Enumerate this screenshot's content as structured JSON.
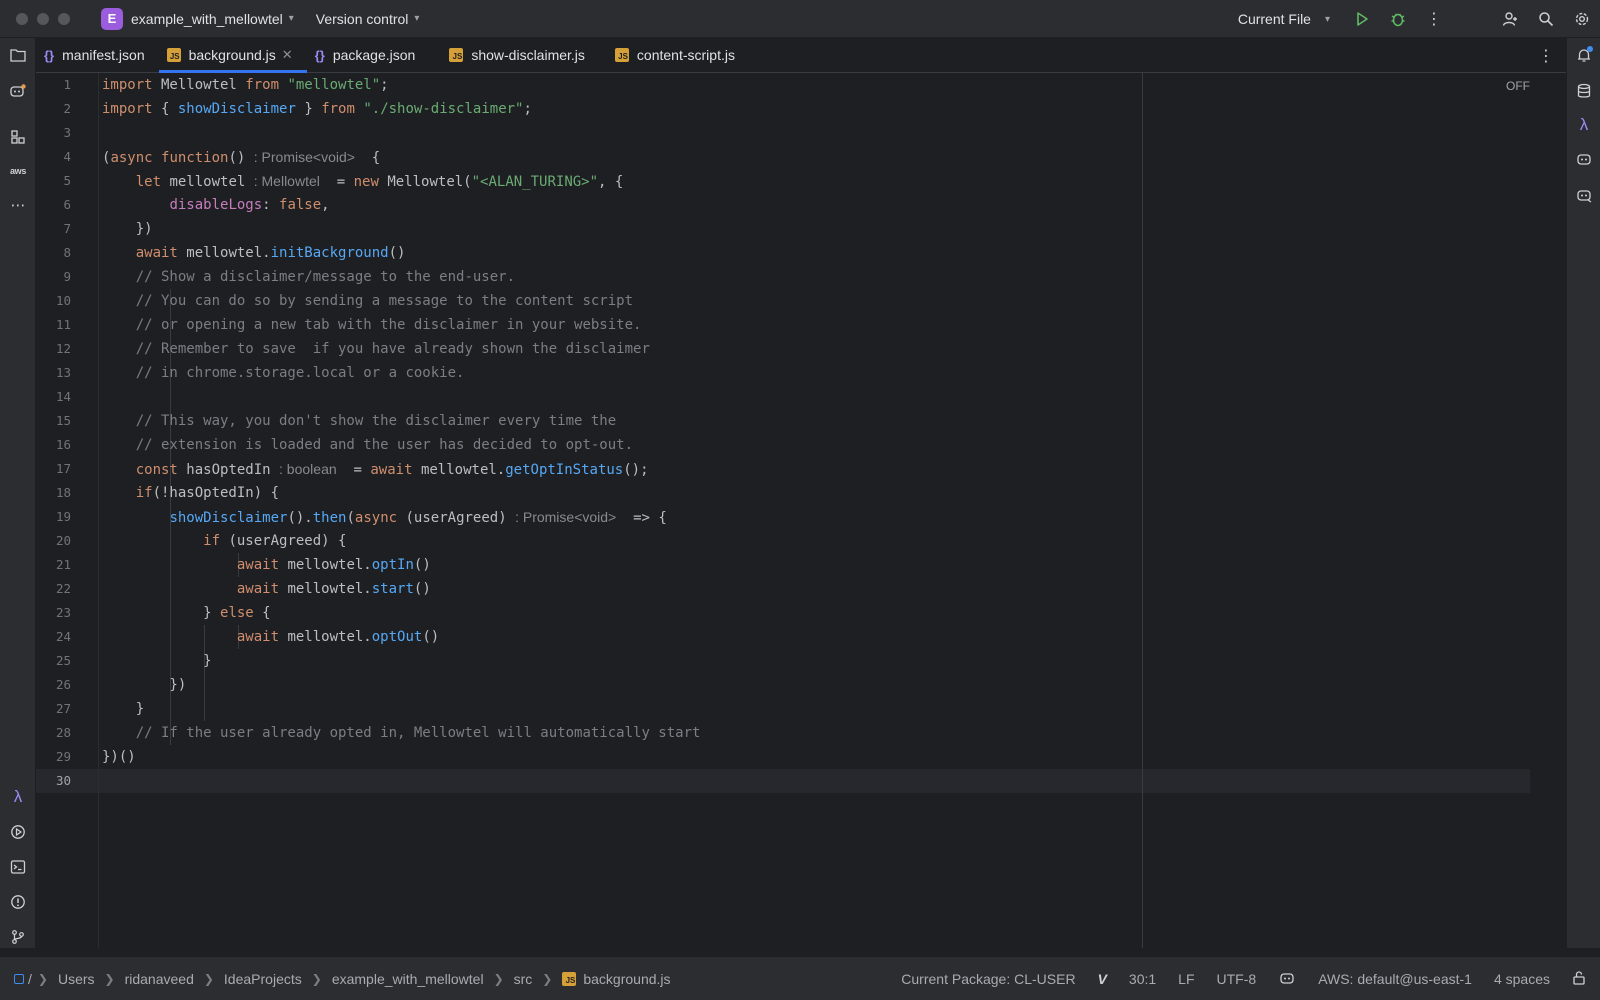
{
  "titlebar": {
    "project_initial": "E",
    "project_name": "example_with_mellowtel",
    "vcs_label": "Version control",
    "run_config": "Current File"
  },
  "tabs": [
    {
      "label": "manifest.json",
      "type": "json"
    },
    {
      "label": "background.js",
      "type": "js",
      "active": true
    },
    {
      "label": "package.json",
      "type": "json"
    },
    {
      "label": "show-disclaimer.js",
      "type": "js"
    },
    {
      "label": "content-script.js",
      "type": "js"
    }
  ],
  "editor": {
    "readonly_badge": "OFF",
    "current_line": 30,
    "line_numbers": [
      "1",
      "2",
      "3",
      "4",
      "5",
      "6",
      "7",
      "8",
      "9",
      "10",
      "11",
      "12",
      "13",
      "14",
      "15",
      "16",
      "17",
      "18",
      "19",
      "20",
      "21",
      "22",
      "23",
      "24",
      "25",
      "26",
      "27",
      "28",
      "29",
      "30"
    ],
    "code": {
      "l1": {
        "a": "import",
        "b": " Mellowtel ",
        "c": "from",
        "d": " ",
        "e": "\"mellowtel\"",
        "f": ";"
      },
      "l2": {
        "a": "import",
        "b": " { ",
        "c": "showDisclaimer",
        "d": " } ",
        "e": "from",
        "f": " ",
        "g": "\"./show-disclaimer\"",
        "h": ";"
      },
      "l4": {
        "a": "(",
        "b": "async",
        "c": " ",
        "d": "function",
        "e": "() ",
        "hint": ": Promise<void>",
        "f": "  {"
      },
      "l5": {
        "a": "    ",
        "b": "let",
        "c": " mellowtel ",
        "hint": ": Mellowtel",
        "d": "  = ",
        "e": "new",
        "f": " Mellowtel(",
        "g": "\"<ALAN_TURING>\"",
        "h": ", {"
      },
      "l6": {
        "a": "        ",
        "b": "disableLogs",
        "c": ": ",
        "d": "false",
        "e": ","
      },
      "l7": {
        "a": "    })"
      },
      "l8": {
        "a": "    ",
        "b": "await",
        "c": " mellowtel.",
        "d": "initBackground",
        "e": "()"
      },
      "l9": {
        "a": "    ",
        "b": "// Show a disclaimer/message to the end-user."
      },
      "l10": {
        "a": "    ",
        "b": "// You can do so by sending a message to the content script"
      },
      "l11": {
        "a": "    ",
        "b": "// or opening a new tab with the disclaimer in your website."
      },
      "l12": {
        "a": "    ",
        "b": "// Remember to save  if you have already shown the disclaimer"
      },
      "l13": {
        "a": "    ",
        "b": "// in chrome.storage.local or a cookie."
      },
      "l15": {
        "a": "    ",
        "b": "// This way, you don't show the disclaimer every time the"
      },
      "l16": {
        "a": "    ",
        "b": "// extension is loaded and the user has decided to opt-out."
      },
      "l17": {
        "a": "    ",
        "b": "const",
        "c": " hasOptedIn ",
        "hint": ": boolean",
        "d": "  = ",
        "e": "await",
        "f": " mellowtel.",
        "g": "getOptInStatus",
        "h": "();"
      },
      "l18": {
        "a": "    ",
        "b": "if",
        "c": "(!hasOptedIn) {"
      },
      "l19": {
        "a": "        ",
        "b": "showDisclaimer",
        "c": "().",
        "d": "then",
        "e": "(",
        "f": "async",
        "g": " (userAgreed) ",
        "hint": ": Promise<void>",
        "h": "  => {"
      },
      "l20": {
        "a": "            ",
        "b": "if",
        "c": " (userAgreed) {"
      },
      "l21": {
        "a": "                ",
        "b": "await",
        "c": " mellowtel.",
        "d": "optIn",
        "e": "()"
      },
      "l22": {
        "a": "                ",
        "b": "await",
        "c": " mellowtel.",
        "d": "start",
        "e": "()"
      },
      "l23": {
        "a": "            } ",
        "b": "else",
        "c": " {"
      },
      "l24": {
        "a": "                ",
        "b": "await",
        "c": " mellowtel.",
        "d": "optOut",
        "e": "()"
      },
      "l25": {
        "a": "            }"
      },
      "l26": {
        "a": "        })"
      },
      "l27": {
        "a": "    }"
      },
      "l28": {
        "a": "    ",
        "b": "// If the user already opted in, Mellowtel will automatically start"
      },
      "l29": {
        "a": "})()"
      }
    }
  },
  "statusbar": {
    "breadcrumbs": [
      "/",
      "Users",
      "ridanaveed",
      "IdeaProjects",
      "example_with_mellowtel",
      "src",
      "background.js"
    ],
    "current_package": "Current Package: CL-USER",
    "vim_badge": "V",
    "cursor_position": "30:1",
    "line_ending": "LF",
    "encoding": "UTF-8",
    "aws_profile": "AWS: default@us-east-1",
    "indent": "4 spaces"
  },
  "colors": {
    "accent": "#3574f0",
    "keyword": "#cf8e6d",
    "string": "#6aab73",
    "function": "#56a8f5",
    "comment": "#7a7e85"
  }
}
